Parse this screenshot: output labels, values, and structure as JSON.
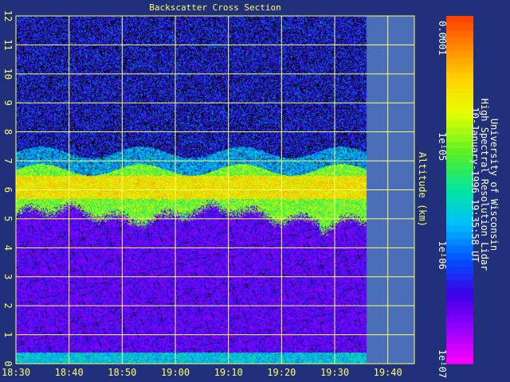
{
  "chart_data": {
    "type": "heatmap",
    "title": "Backscatter Cross Section",
    "ylabel": "Altitude (km)",
    "x_tick_labels": [
      "18:30",
      "18:40",
      "18:50",
      "19:00",
      "19:10",
      "19:20",
      "19:30",
      "19:40"
    ],
    "y_ticks": [
      0,
      1,
      2,
      3,
      4,
      5,
      6,
      7,
      8,
      9,
      10,
      11,
      12
    ],
    "y_tick_labels": [
      "0",
      "1",
      "2",
      "3",
      "4",
      "5",
      "6",
      "7",
      "8",
      "9",
      "10",
      "11",
      "12"
    ],
    "ylim": [
      0,
      12
    ],
    "xlim_minutes_after_1830": [
      0,
      75
    ],
    "data_end_minute": 66,
    "grid": true,
    "colorbar": {
      "scale": "log",
      "range": [
        1e-07,
        0.00016
      ],
      "tick_values": [
        1e-07,
        1e-06,
        1e-05,
        0.0001
      ],
      "tick_labels": [
        "1e-07",
        "1e-06",
        "1e-05",
        "0.0001"
      ]
    },
    "features": {
      "cloud_layer_km": [
        5.0,
        7.0
      ],
      "cloud_core_km": [
        5.7,
        6.5
      ],
      "surface_layer_km": [
        0.0,
        0.4
      ]
    }
  },
  "annotation": {
    "line1": "University of Wisconsin",
    "line2": "High Spectral Resolution Lidar",
    "line3": "10-January-1996 19:35:58 UT"
  },
  "colors": {
    "background": "#21307a",
    "grid": "#ffff66",
    "nodata": "#4a6fb8"
  }
}
